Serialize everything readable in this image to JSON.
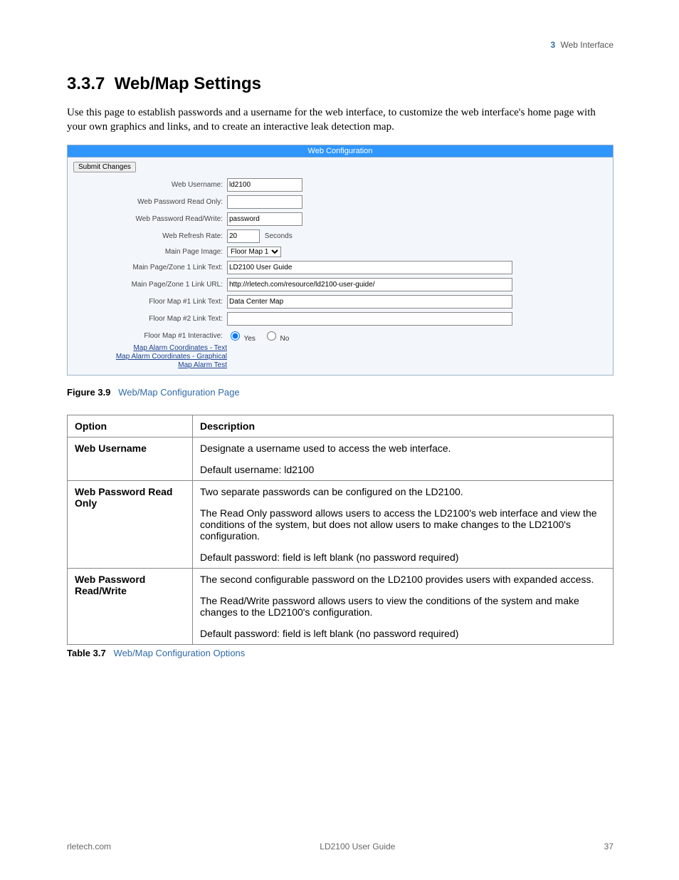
{
  "header": {
    "chapter_num": "3",
    "chapter_title": "Web Interface"
  },
  "section": {
    "number": "3.3.7",
    "title": "Web/Map Settings"
  },
  "intro": "Use this page to establish passwords and a username for the web interface, to customize the web interface's home page with your own graphics and links, and to create an interactive leak detection map.",
  "screenshot": {
    "title": "Web Configuration",
    "submit": "Submit Changes",
    "fields": {
      "username_label": "Web Username:",
      "username_value": "ld2100",
      "pw_ro_label": "Web Password Read Only:",
      "pw_ro_value": "",
      "pw_rw_label": "Web Password Read/Write:",
      "pw_rw_value": "password",
      "refresh_label": "Web Refresh Rate:",
      "refresh_value": "20",
      "refresh_suffix": "Seconds",
      "image_label": "Main Page Image:",
      "image_value": "Floor Map 1",
      "z1text_label": "Main Page/Zone 1 Link Text:",
      "z1text_value": "LD2100 User Guide",
      "z1url_label": "Main Page/Zone 1 Link URL:",
      "z1url_value": "http://rletech.com/resource/ld2100-user-guide/",
      "fm1_label": "Floor Map #1 Link Text:",
      "fm1_value": "Data Center Map",
      "fm2_label": "Floor Map #2 Link Text:",
      "fm2_value": "",
      "fm1i_label": "Floor Map #1 Interactive:",
      "fm1i_yes": "Yes",
      "fm1i_no": "No",
      "link_text": "Map Alarm Coordinates - Text",
      "link_graph": "Map Alarm Coordinates - Graphical",
      "link_test": "Map Alarm Test"
    }
  },
  "figure": {
    "label": "Figure 3.9",
    "title": "Web/Map Configuration Page"
  },
  "table": {
    "head_option": "Option",
    "head_desc": "Description",
    "rows": [
      {
        "option": "Web Username",
        "desc": [
          "Designate a username used to access the web interface.",
          "Default username: ld2100"
        ]
      },
      {
        "option": "Web Password Read Only",
        "desc": [
          "Two separate passwords can be configured on the LD2100.",
          "The Read Only password allows users to access the LD2100's web interface and view the conditions of the system, but does not allow users to make changes to the LD2100's configuration.",
          "Default password: field is left blank (no password required)"
        ]
      },
      {
        "option": "Web Password Read/Write",
        "desc": [
          "The second configurable password on the LD2100 provides users with expanded access.",
          "The Read/Write password allows users to view the conditions of the system and make changes to the LD2100's configuration.",
          "Default password: field is left blank (no password required)"
        ]
      }
    ]
  },
  "table_caption": {
    "label": "Table 3.7",
    "title": "Web/Map Configuration Options"
  },
  "footer": {
    "left": "rletech.com",
    "center": "LD2100 User Guide",
    "right": "37"
  }
}
